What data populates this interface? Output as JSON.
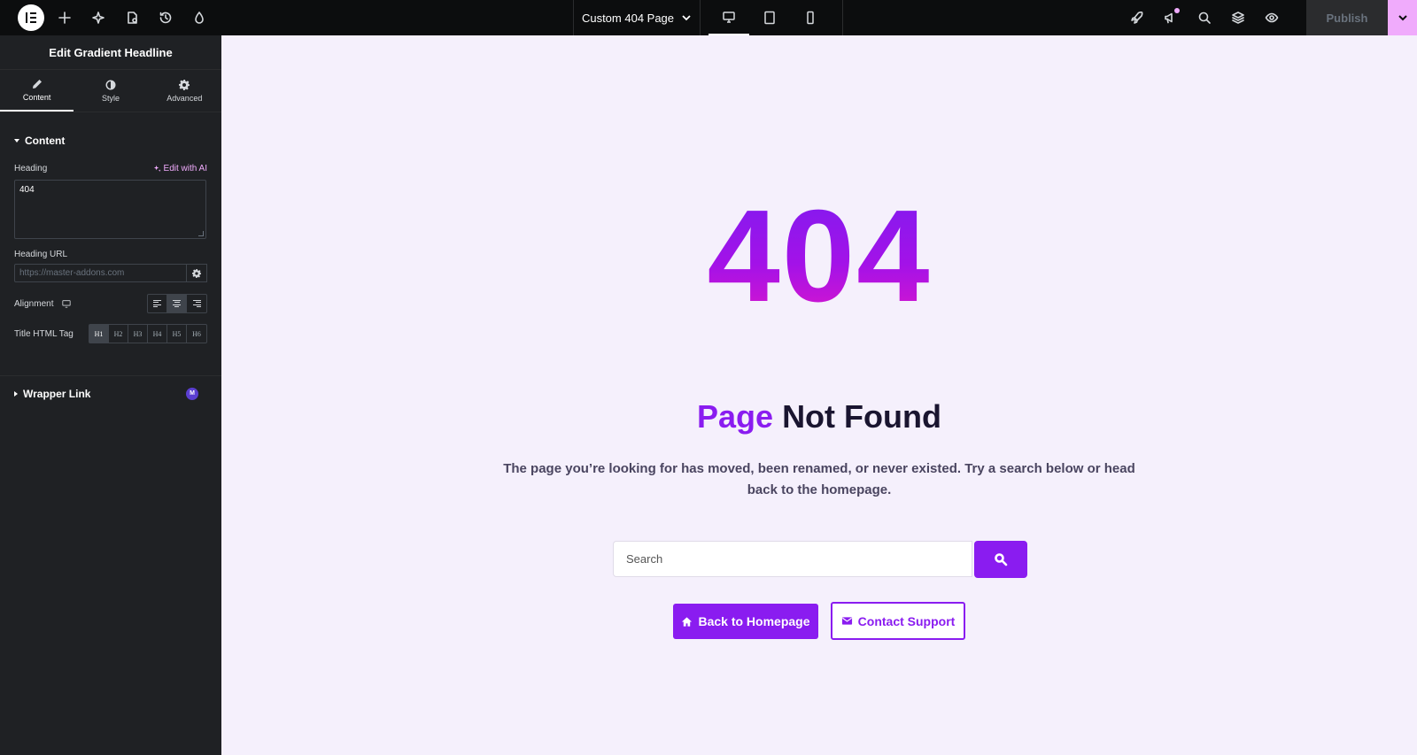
{
  "topbar": {
    "page_name": "Custom 404 Page",
    "publish_label": "Publish"
  },
  "panel": {
    "title": "Edit Gradient Headline",
    "tabs": [
      {
        "label": "Content",
        "icon": "pencil-icon"
      },
      {
        "label": "Style",
        "icon": "contrast-icon"
      },
      {
        "label": "Advanced",
        "icon": "gear-icon"
      }
    ],
    "section_content": "Content",
    "heading_label": "Heading",
    "edit_ai_label": "Edit with AI",
    "heading_value": "404",
    "heading_url_label": "Heading URL",
    "heading_url_placeholder": "https://master-addons.com",
    "alignment_label": "Alignment",
    "title_tag_label": "Title HTML Tag",
    "title_tags": [
      "H1",
      "H2",
      "H3",
      "H4",
      "H5",
      "H6"
    ],
    "wrapper_link_label": "Wrapper Link",
    "wrapper_badge": "M"
  },
  "canvas": {
    "big_heading": "404",
    "subheading_accent": "Page",
    "subheading_rest": "Not Found",
    "description": "The page you’re looking for has moved, been renamed, or never existed. Try a search below or head back to the homepage.",
    "search_placeholder": "Search",
    "home_button": "Back to Homepage",
    "support_button": "Contact Support"
  },
  "colors": {
    "accent": "#8a1cf0",
    "gradient_start": "#7e1cf0",
    "gradient_end": "#e017c8",
    "panel_bg": "#1f2124",
    "topbar_bg": "#0c0d0e",
    "canvas_bg": "#f5f0fc",
    "ai_pink": "#f0abfc"
  }
}
